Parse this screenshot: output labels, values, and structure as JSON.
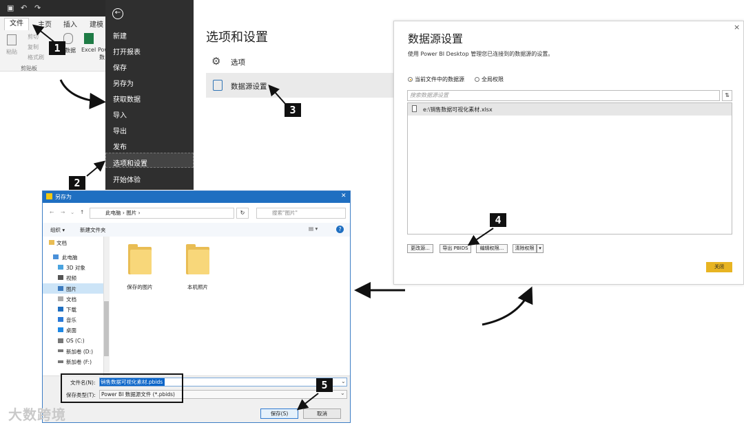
{
  "ribbon": {
    "tabs": [
      "文件",
      "主页",
      "插入",
      "建模"
    ],
    "paste_label": "粘贴",
    "cut_label": "剪切",
    "copy_label": "复制",
    "format_painter_label": "格式刷",
    "clipboard_group": "剪贴板",
    "data_label": "数据",
    "excel_label": "Excel",
    "pow_label": "Pow",
    "data2_label": "数"
  },
  "backstage": {
    "items": [
      "新建",
      "打开报表",
      "保存",
      "另存为",
      "获取数据",
      "导入",
      "导出",
      "发布",
      "选项和设置",
      "开始体验"
    ]
  },
  "options": {
    "title": "选项和设置",
    "options_label": "选项",
    "datasource_label": "数据源设置"
  },
  "datasource_dialog": {
    "title": "数据源设置",
    "description": "使用 Power BI Desktop 管理您已连接到的数据源的设置。",
    "radio_current": "当前文件中的数据源",
    "radio_global": "全局权限",
    "search_placeholder": "搜索数据源设置",
    "row": "e:\\销售数据可视化素材.xlsx",
    "btn_change": "更改源...",
    "btn_export": "导出 PBIDS",
    "btn_edit": "编辑权限...",
    "btn_clear": "清除权限",
    "btn_close": "关闭",
    "close_x": "×"
  },
  "saveas": {
    "title": "另存为",
    "address_parts": "此电脑  ›  图片  ›",
    "search_placeholder": "搜索\"图片\"",
    "organize": "组织 ▾",
    "new_folder": "新建文件夹",
    "nav_items": [
      "文档",
      "此电脑",
      "3D 对象",
      "视频",
      "图片",
      "文档",
      "下载",
      "音乐",
      "桌面",
      "OS (C:)",
      "新加卷 (D:)",
      "新加卷 (F:)"
    ],
    "folders": [
      "保存的图片",
      "本机照片"
    ],
    "filename_label": "文件名(N):",
    "filename_value": "销售数据可视化素材.pbids",
    "filetype_label": "保存类型(T):",
    "filetype_value": "Power BI 数据源文件 (*.pbids)",
    "save_btn": "保存(S)",
    "cancel_btn": "取消"
  },
  "badges": [
    "1",
    "2",
    "3",
    "4",
    "5"
  ],
  "watermark": "大数跨境",
  "colors": {
    "backstage_bg": "#2f2f2f",
    "accent_yellow": "#e8b422",
    "titlebar_blue": "#1f6fc1"
  }
}
